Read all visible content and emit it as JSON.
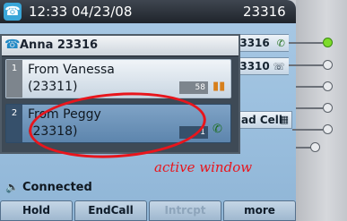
{
  "status_bar": {
    "datetime": "12:33 04/23/08",
    "extension": "23316"
  },
  "lines": [
    {
      "label": "23316",
      "icon": "phone-active-icon"
    },
    {
      "label": "23310",
      "icon": "phone-idle-icon"
    },
    {
      "label": "ad Cell",
      "icon": "keypad-icon"
    }
  ],
  "call_window": {
    "title": "Anna 23316",
    "calls": [
      {
        "number": "1",
        "line1": "From Vanessa",
        "line2": "(23311)",
        "duration": "58",
        "state_icon": "hold-icon"
      },
      {
        "number": "2",
        "line1": "From Peggy",
        "line2": "(23318)",
        "duration": "1",
        "state_icon": "active-call-icon"
      }
    ]
  },
  "annotation": {
    "text": "active window",
    "color": "#e8151c"
  },
  "status": {
    "text": "Connected",
    "icon": "speaker-icon"
  },
  "softkeys": [
    {
      "label": "Hold",
      "enabled": true
    },
    {
      "label": "EndCall",
      "enabled": true
    },
    {
      "label": "Intrcpt",
      "enabled": false
    },
    {
      "label": "more",
      "enabled": true
    }
  ]
}
